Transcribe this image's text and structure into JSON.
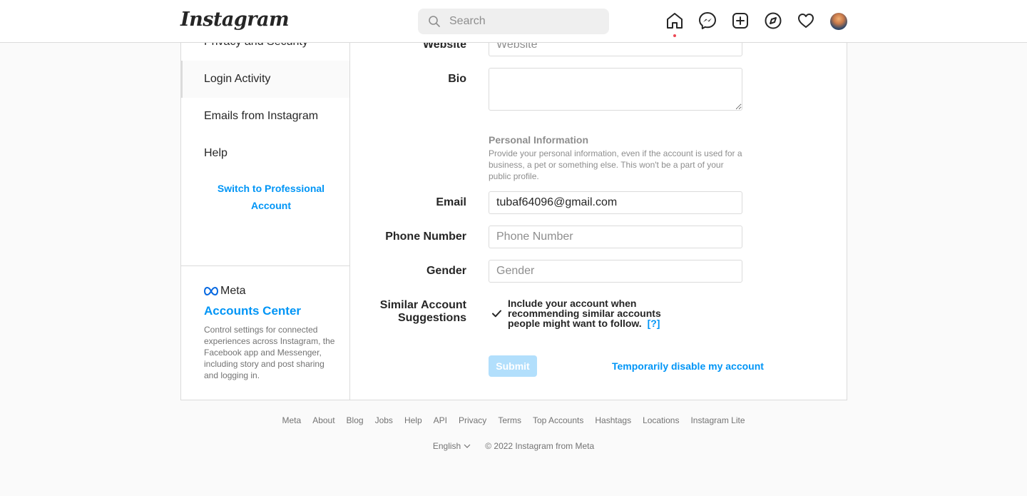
{
  "header": {
    "logo": "Instagram",
    "search_placeholder": "Search"
  },
  "icons": {
    "home": "home-icon",
    "messenger": "messenger-icon",
    "create": "new-post-icon",
    "explore": "compass-icon",
    "activity": "heart-icon",
    "profile": "avatar"
  },
  "sidebar": {
    "items": [
      {
        "label": "Privacy and Security"
      },
      {
        "label": "Login Activity"
      },
      {
        "label": "Emails from Instagram"
      },
      {
        "label": "Help"
      }
    ],
    "switch_label": "Switch to Professional Account",
    "meta_label": "Meta",
    "accounts_center": "Accounts Center",
    "meta_description": "Control settings for connected experiences across Instagram, the Facebook app and Messenger, including story and post sharing and logging in."
  },
  "form": {
    "website_label": "Website",
    "website_placeholder": "Website",
    "bio_label": "Bio",
    "personal_info_title": "Personal Information",
    "personal_info_desc": "Provide your personal information, even if the account is used for a business, a pet or something else. This won't be a part of your public profile.",
    "email_label": "Email",
    "email_value": "tubaf64096@gmail.com",
    "phone_label": "Phone Number",
    "phone_placeholder": "Phone Number",
    "gender_label": "Gender",
    "gender_placeholder": "Gender",
    "similar_label": "Similar Account Suggestions",
    "similar_checked": true,
    "similar_text": "Include your account when recommending similar accounts people might want to follow.",
    "similar_help": "[?]",
    "submit_label": "Submit",
    "disable_label": "Temporarily disable my account"
  },
  "footer": {
    "links": [
      "Meta",
      "About",
      "Blog",
      "Jobs",
      "Help",
      "API",
      "Privacy",
      "Terms",
      "Top Accounts",
      "Hashtags",
      "Locations",
      "Instagram Lite"
    ],
    "language": "English",
    "copyright": "© 2022 Instagram from Meta"
  },
  "colors": {
    "accent": "#0095f6",
    "notification_dot": "#ed4956",
    "submit_disabled": "#b2dffc"
  }
}
